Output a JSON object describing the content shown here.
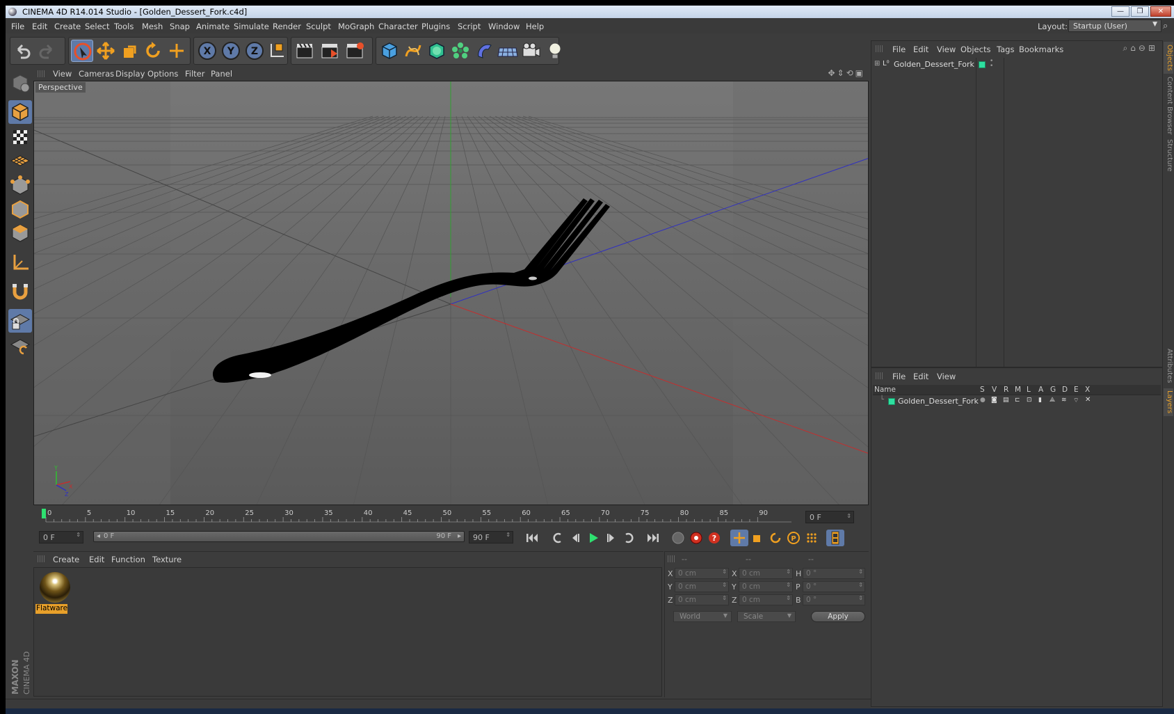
{
  "window": {
    "title": "CINEMA 4D R14.014 Studio - [Golden_Dessert_Fork.c4d]",
    "minimize_label": "—",
    "restore_label": "❐",
    "close_label": "✕"
  },
  "menubar": {
    "items": [
      "File",
      "Edit",
      "Create",
      "Select",
      "Tools",
      "Mesh",
      "Snap",
      "Animate",
      "Simulate",
      "Render",
      "Sculpt",
      "MoGraph",
      "Character",
      "Plugins",
      "Script",
      "Window",
      "Help"
    ],
    "layout_label": "Layout:",
    "layout_value": "Startup (User)"
  },
  "viewport": {
    "menu": [
      "View",
      "Cameras",
      "Display",
      "Options",
      "Filter",
      "Panel"
    ],
    "label": "Perspective",
    "axis_y": "Y",
    "axis_x": "X",
    "axis_z": "Z"
  },
  "timeline": {
    "ticks": [
      "0",
      "5",
      "10",
      "15",
      "20",
      "25",
      "30",
      "35",
      "40",
      "45",
      "50",
      "55",
      "60",
      "65",
      "70",
      "75",
      "80",
      "85",
      "90"
    ],
    "current_frame_right": "0 F",
    "start_frame": "0 F",
    "range_start": "0 F",
    "range_end": "90 F",
    "end_frame": "90 F"
  },
  "material_manager": {
    "menu": [
      "Create",
      "Edit",
      "Function",
      "Texture"
    ],
    "material_name": "Flatware"
  },
  "coordinates": {
    "headers": [
      "--",
      "--",
      "--"
    ],
    "pos_labels": [
      "X",
      "Y",
      "Z"
    ],
    "pos_values": [
      "0 cm",
      "0 cm",
      "0 cm"
    ],
    "size_labels": [
      "X",
      "Y",
      "Z"
    ],
    "size_values": [
      "0 cm",
      "0 cm",
      "0 cm"
    ],
    "rot_labels": [
      "H",
      "P",
      "B"
    ],
    "rot_values": [
      "0 °",
      "0 °",
      "0 °"
    ],
    "mode_select": "World",
    "scale_select": "Scale",
    "apply_label": "Apply"
  },
  "object_manager": {
    "menu": [
      "File",
      "Edit",
      "View",
      "Objects",
      "Tags",
      "Bookmarks"
    ],
    "object_name": "Golden_Dessert_Fork",
    "object_color": "#2ee0a0"
  },
  "layer_manager": {
    "menu": [
      "File",
      "Edit",
      "View"
    ],
    "columns": [
      "Name",
      "S",
      "V",
      "R",
      "M",
      "L",
      "A",
      "G",
      "D",
      "E",
      "X"
    ],
    "layer_name": "Golden_Dessert_Fork"
  },
  "side_tabs": [
    "Objects",
    "Content Browser",
    "Structure",
    "Attributes",
    "Layers"
  ],
  "logo": {
    "brand": "MAXON",
    "product": "CINEMA 4D"
  },
  "colors": {
    "accent": "#e8a02a",
    "active_tool": "#5f7aa8",
    "x_axis": "#c03030",
    "y_axis": "#30a030",
    "z_axis": "#3030c0"
  }
}
